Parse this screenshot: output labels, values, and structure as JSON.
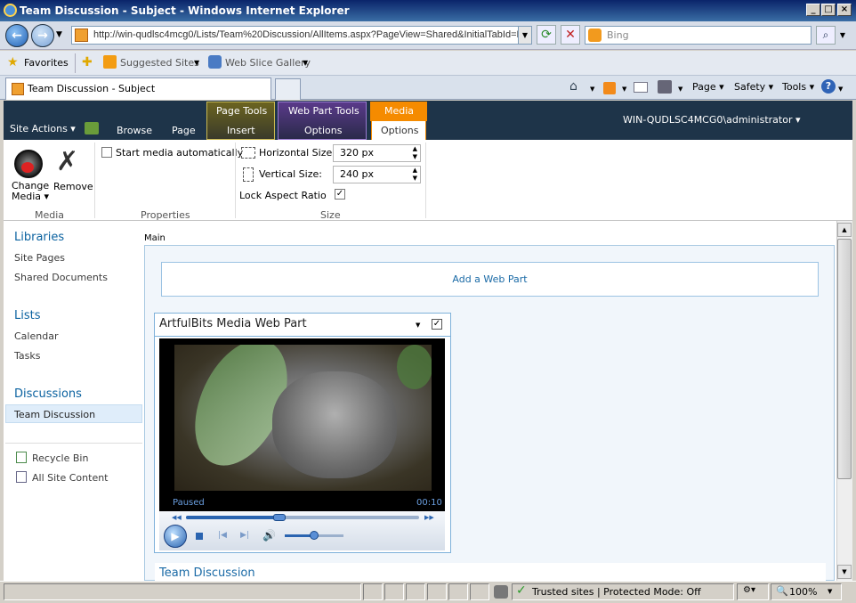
{
  "window": {
    "title": "Team Discussion - Subject - Windows Internet Explorer"
  },
  "address": {
    "url": "http://win-qudlsc4mcg0/Lists/Team%20Discussion/AllItems.aspx?PageView=Shared&InitialTabId=R"
  },
  "search": {
    "placeholder": "Bing"
  },
  "favorites": {
    "label": "Favorites",
    "items": [
      "Suggested Sites",
      "Web Slice Gallery"
    ]
  },
  "tab": {
    "title": "Team Discussion - Subject"
  },
  "commandbar": {
    "page": "Page",
    "safety": "Safety",
    "tools": "Tools"
  },
  "ribbon": {
    "site_actions": "Site Actions",
    "tabs": {
      "browse": "Browse",
      "page": "Page",
      "insert": "Insert",
      "wp_options": "Options",
      "media_options": "Options"
    },
    "contexts": {
      "page_tools": "Page Tools",
      "web_part_tools": "Web Part Tools",
      "media": "Media"
    },
    "user": "WIN-QUDLSC4MCG0\\administrator",
    "change_media": "Change Media",
    "remove": "Remove",
    "start_media": "Start media automatically",
    "horizontal_size_label": "Horizontal Size:",
    "horizontal_size": "320 px",
    "vertical_size_label": "Vertical Size:",
    "vertical_size": "240 px",
    "lock_aspect": "Lock Aspect Ratio",
    "groups": {
      "media": "Media",
      "properties": "Properties",
      "size": "Size"
    }
  },
  "leftnav": {
    "libraries": "Libraries",
    "site_pages": "Site Pages",
    "shared_documents": "Shared Documents",
    "lists": "Lists",
    "calendar": "Calendar",
    "tasks": "Tasks",
    "discussions": "Discussions",
    "team_discussion": "Team Discussion",
    "recycle_bin": "Recycle Bin",
    "all_site_content": "All Site Content"
  },
  "main": {
    "zone_label": "Main",
    "add_web_part": "Add a Web Part",
    "webpart_title": "ArtfulBits Media Web Part",
    "player_status": "Paused",
    "player_time": "00:10",
    "player_progress": 0.4,
    "player_volume": 0.5,
    "list_title": "Team Discussion"
  },
  "status": {
    "trusted": "Trusted sites | Protected Mode: Off",
    "zoom": "100%"
  }
}
